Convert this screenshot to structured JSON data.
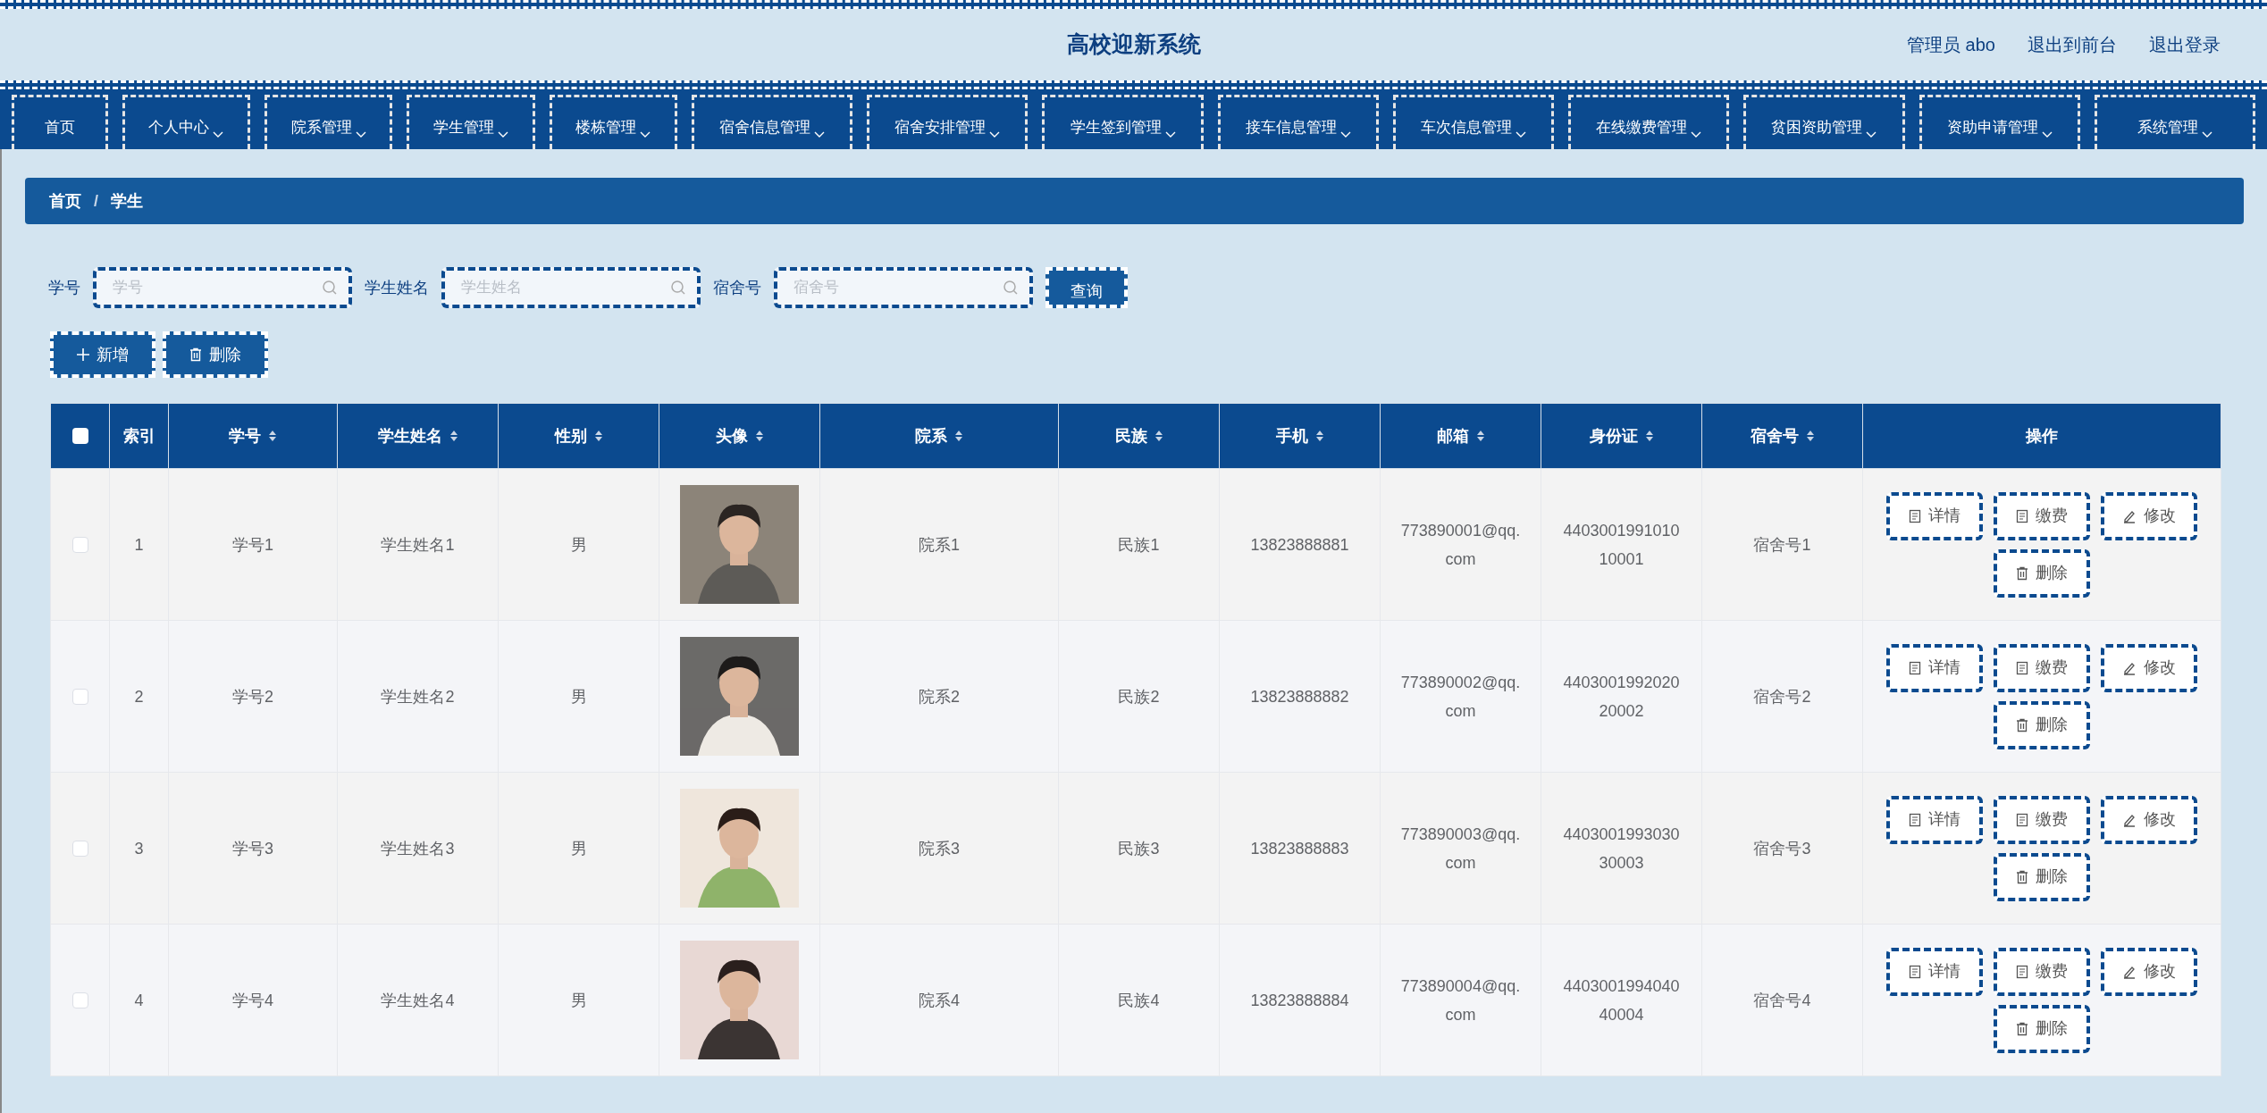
{
  "header": {
    "title": "高校迎新系统",
    "links": [
      "管理员 abo",
      "退出到前台",
      "退出登录"
    ]
  },
  "nav": [
    {
      "label": "首页",
      "dropdown": false
    },
    {
      "label": "个人中心",
      "dropdown": true
    },
    {
      "label": "院系管理",
      "dropdown": true
    },
    {
      "label": "学生管理",
      "dropdown": true
    },
    {
      "label": "楼栋管理",
      "dropdown": true
    },
    {
      "label": "宿舍信息管理",
      "dropdown": true
    },
    {
      "label": "宿舍安排管理",
      "dropdown": true
    },
    {
      "label": "学生签到管理",
      "dropdown": true
    },
    {
      "label": "接车信息管理",
      "dropdown": true
    },
    {
      "label": "车次信息管理",
      "dropdown": true
    },
    {
      "label": "在线缴费管理",
      "dropdown": true
    },
    {
      "label": "贫困资助管理",
      "dropdown": true
    },
    {
      "label": "资助申请管理",
      "dropdown": true
    },
    {
      "label": "系统管理",
      "dropdown": true
    }
  ],
  "breadcrumb": {
    "items": [
      "首页",
      "学生"
    ],
    "separator": "/"
  },
  "search": {
    "fields": [
      {
        "label": "学号",
        "placeholder": "学号"
      },
      {
        "label": "学生姓名",
        "placeholder": "学生姓名"
      },
      {
        "label": "宿舍号",
        "placeholder": "宿舍号"
      }
    ],
    "button": "查询"
  },
  "actions": [
    {
      "kind": "add",
      "label": "新增"
    },
    {
      "kind": "delete",
      "label": "删除"
    }
  ],
  "table": {
    "select_all": {
      "checked": false
    },
    "columns": [
      {
        "label": "索引",
        "sortable": false
      },
      {
        "label": "学号",
        "sortable": true
      },
      {
        "label": "学生姓名",
        "sortable": true
      },
      {
        "label": "性别",
        "sortable": true
      },
      {
        "label": "头像",
        "sortable": true
      },
      {
        "label": "院系",
        "sortable": true
      },
      {
        "label": "民族",
        "sortable": true
      },
      {
        "label": "手机",
        "sortable": true
      },
      {
        "label": "邮箱",
        "sortable": true
      },
      {
        "label": "身份证",
        "sortable": true
      },
      {
        "label": "宿舍号",
        "sortable": true
      },
      {
        "label": "操作",
        "sortable": false
      }
    ],
    "rows": [
      {
        "checked": false,
        "cells": [
          {
            "kind": "text",
            "text": "1"
          },
          {
            "kind": "text",
            "text": "学号1"
          },
          {
            "kind": "text",
            "text": "学生姓名1"
          },
          {
            "kind": "text",
            "text": "男"
          },
          {
            "kind": "picture"
          },
          {
            "kind": "text",
            "text": "院系1"
          },
          {
            "kind": "text",
            "text": "民族1"
          },
          {
            "kind": "text",
            "text": "13823888881"
          },
          {
            "kind": "text",
            "text": "773890001@qq.com"
          },
          {
            "kind": "text",
            "text": "440300199101010001"
          },
          {
            "kind": "text",
            "text": "宿舍号1"
          }
        ],
        "buttons": [
          {
            "kind": "detail",
            "label": "详情"
          },
          {
            "kind": "pay",
            "label": "缴费"
          },
          {
            "kind": "edit",
            "label": "修改"
          },
          {
            "kind": "delete",
            "label": "删除"
          }
        ]
      },
      {
        "checked": false,
        "cells": [
          {
            "kind": "text",
            "text": "2"
          },
          {
            "kind": "text",
            "text": "学号2"
          },
          {
            "kind": "text",
            "text": "学生姓名2"
          },
          {
            "kind": "text",
            "text": "男"
          },
          {
            "kind": "picture"
          },
          {
            "kind": "text",
            "text": "院系2"
          },
          {
            "kind": "text",
            "text": "民族2"
          },
          {
            "kind": "text",
            "text": "13823888882"
          },
          {
            "kind": "text",
            "text": "773890002@qq.com"
          },
          {
            "kind": "text",
            "text": "440300199202020002"
          },
          {
            "kind": "text",
            "text": "宿舍号2"
          }
        ],
        "buttons": [
          {
            "kind": "detail",
            "label": "详情"
          },
          {
            "kind": "pay",
            "label": "缴费"
          },
          {
            "kind": "edit",
            "label": "修改"
          },
          {
            "kind": "delete",
            "label": "删除"
          }
        ]
      },
      {
        "checked": false,
        "cells": [
          {
            "kind": "text",
            "text": "3"
          },
          {
            "kind": "text",
            "text": "学号3"
          },
          {
            "kind": "text",
            "text": "学生姓名3"
          },
          {
            "kind": "text",
            "text": "男"
          },
          {
            "kind": "picture"
          },
          {
            "kind": "text",
            "text": "院系3"
          },
          {
            "kind": "text",
            "text": "民族3"
          },
          {
            "kind": "text",
            "text": "13823888883"
          },
          {
            "kind": "text",
            "text": "773890003@qq.com"
          },
          {
            "kind": "text",
            "text": "440300199303030003"
          },
          {
            "kind": "text",
            "text": "宿舍号3"
          }
        ],
        "buttons": [
          {
            "kind": "detail",
            "label": "详情"
          },
          {
            "kind": "pay",
            "label": "缴费"
          },
          {
            "kind": "edit",
            "label": "修改"
          },
          {
            "kind": "delete",
            "label": "删除"
          }
        ]
      },
      {
        "checked": false,
        "cells": [
          {
            "kind": "text",
            "text": "4"
          },
          {
            "kind": "text",
            "text": "学号4"
          },
          {
            "kind": "text",
            "text": "学生姓名4"
          },
          {
            "kind": "text",
            "text": "男"
          },
          {
            "kind": "picture"
          },
          {
            "kind": "text",
            "text": "院系4"
          },
          {
            "kind": "text",
            "text": "民族4"
          },
          {
            "kind": "text",
            "text": "13823888884"
          },
          {
            "kind": "text",
            "text": "773890004@qq.com"
          },
          {
            "kind": "text",
            "text": "440300199404040004"
          },
          {
            "kind": "text",
            "text": "宿舍号4"
          }
        ],
        "buttons": [
          {
            "kind": "detail",
            "label": "详情"
          },
          {
            "kind": "pay",
            "label": "缴费"
          },
          {
            "kind": "edit",
            "label": "修改"
          },
          {
            "kind": "delete",
            "label": "删除"
          }
        ]
      }
    ]
  }
}
